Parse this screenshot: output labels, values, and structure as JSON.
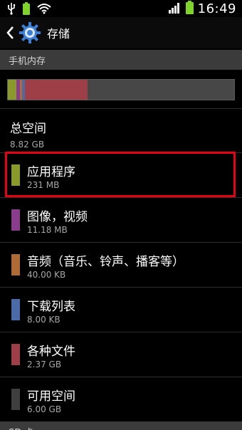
{
  "statusbar": {
    "time": "16:49"
  },
  "actionbar": {
    "title": "存储"
  },
  "sections": {
    "internal": "手机内存",
    "sd": "SD 卡"
  },
  "usage": {
    "segments": [
      {
        "name": "apps",
        "color": "#8a9a2a"
      },
      {
        "name": "images",
        "color": "#8a3d8d"
      },
      {
        "name": "audio",
        "color": "#b06a36"
      },
      {
        "name": "downloads",
        "color": "#4a6aa8"
      },
      {
        "name": "misc",
        "color": "#9e3e46"
      },
      {
        "name": "free",
        "color": "#474747"
      }
    ]
  },
  "total": {
    "label": "总空间",
    "value": "8.82 GB"
  },
  "items": [
    {
      "label": "应用程序",
      "size": "231 MB",
      "color": "#8a9a2a"
    },
    {
      "label": "图像，视频",
      "size": "11.18 MB",
      "color": "#8a3d8d"
    },
    {
      "label": "音频（音乐、铃声、播客等）",
      "size": "40.00 KB",
      "color": "#b06a36"
    },
    {
      "label": "下载列表",
      "size": "8.00 KB",
      "color": "#4a6aa8"
    },
    {
      "label": "各种文件",
      "size": "2.37 GB",
      "color": "#9e3e46"
    },
    {
      "label": "可用空间",
      "size": "6.00 GB",
      "color": "#3f3f3f"
    }
  ]
}
